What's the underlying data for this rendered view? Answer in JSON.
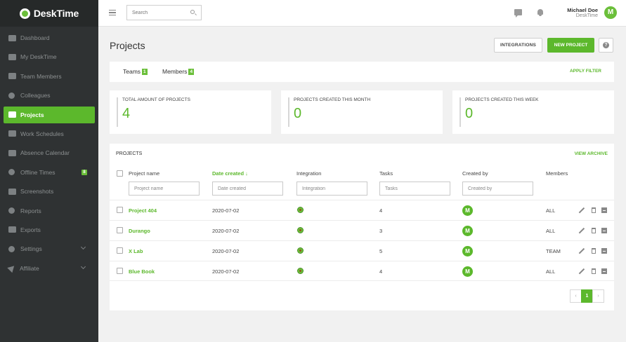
{
  "app": {
    "name": "DeskTime"
  },
  "sidebar": {
    "items": [
      {
        "label": "Dashboard",
        "icon": "bar-chart-icon"
      },
      {
        "label": "My DeskTime",
        "icon": "monitor-icon"
      },
      {
        "label": "Team Members",
        "icon": "users-icon"
      },
      {
        "label": "Colleagues",
        "icon": "user-icon"
      },
      {
        "label": "Projects",
        "icon": "folder-icon",
        "active": true
      },
      {
        "label": "Work Schedules",
        "icon": "briefcase-icon"
      },
      {
        "label": "Absence Calendar",
        "icon": "calendar-icon"
      },
      {
        "label": "Offline Times",
        "icon": "clock-icon",
        "badge": "8"
      },
      {
        "label": "Screenshots",
        "icon": "camera-icon"
      },
      {
        "label": "Reports",
        "icon": "pie-chart-icon"
      },
      {
        "label": "Exports",
        "icon": "export-icon"
      },
      {
        "label": "Settings",
        "icon": "gear-icon",
        "chevron": true
      },
      {
        "label": "Affiliate",
        "icon": "send-icon",
        "chevron": true
      }
    ]
  },
  "header": {
    "search_placeholder": "Search",
    "user_name": "Michael Doe",
    "user_company": "DeskTime",
    "avatar_letter": "M"
  },
  "page": {
    "title": "Projects",
    "integrations_label": "INTEGRATIONS",
    "new_project_label": "NEW PROJECT",
    "help_label": "?"
  },
  "filters": {
    "teams_label": "Teams",
    "teams_count": "1",
    "members_label": "Members",
    "members_count": "4",
    "apply_label": "APPLY FILTER"
  },
  "stats": [
    {
      "label": "TOTAL AMOUNT OF PROJECTS",
      "value": "4"
    },
    {
      "label": "PROJECTS CREATED THIS MONTH",
      "value": "0"
    },
    {
      "label": "PROJECTS CREATED THIS WEEK",
      "value": "0"
    }
  ],
  "table": {
    "title": "PROJECTS",
    "archive_label": "VIEW ARCHIVE",
    "columns": {
      "name": "Project name",
      "date": "Date created ↓",
      "integration": "Integration",
      "tasks": "Tasks",
      "created_by": "Created by",
      "members": "Members"
    },
    "filter_placeholders": {
      "name": "Project name",
      "date": "Date created",
      "integration": "Integration",
      "tasks": "Tasks",
      "created_by": "Created by"
    },
    "rows": [
      {
        "name": "Project 404",
        "date": "2020-07-02",
        "tasks": "4",
        "creator": "M",
        "members": "ALL"
      },
      {
        "name": "Durango",
        "date": "2020-07-02",
        "tasks": "3",
        "creator": "M",
        "members": "ALL"
      },
      {
        "name": "X Lab",
        "date": "2020-07-02",
        "tasks": "5",
        "creator": "M",
        "members": "TEAM"
      },
      {
        "name": "Blue Book",
        "date": "2020-07-02",
        "tasks": "4",
        "creator": "M",
        "members": "ALL"
      }
    ]
  },
  "pagination": {
    "prev": "‹",
    "current": "1",
    "next": "›"
  },
  "colors": {
    "accent": "#5cb82c",
    "sidebar": "#2f3233"
  }
}
